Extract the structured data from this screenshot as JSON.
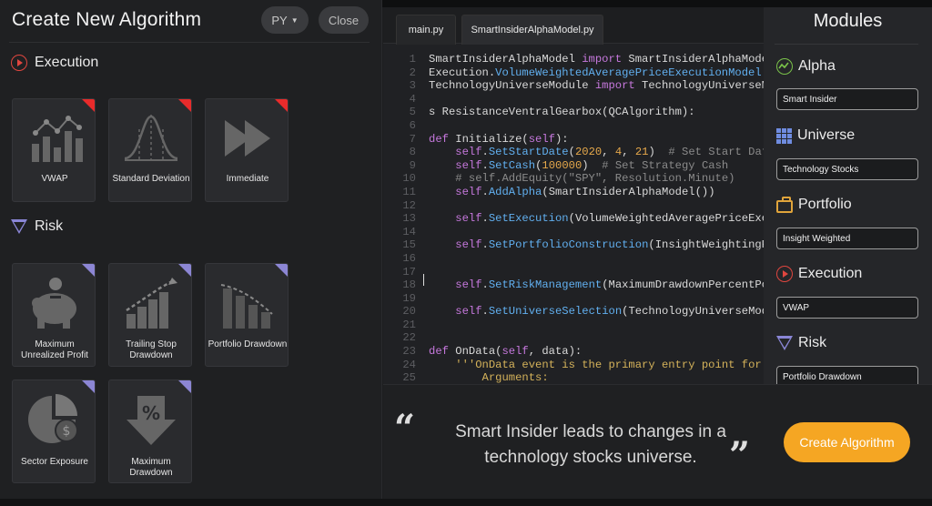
{
  "header": {
    "title": "Create New Algorithm",
    "language_label": "PY",
    "close_label": "Close"
  },
  "sections": {
    "execution_label": "Execution",
    "risk_label": "Risk"
  },
  "execution_cards": [
    {
      "label": "VWAP",
      "icon": "vwap-chart-icon",
      "selected": true
    },
    {
      "label": "Standard Deviation",
      "icon": "bell-curve-icon",
      "selected": true
    },
    {
      "label": "Immediate",
      "icon": "fast-forward-icon",
      "selected": true
    }
  ],
  "risk_cards": [
    {
      "label": "Maximum Unrealized Profit",
      "icon": "piggy-bank-icon"
    },
    {
      "label": "Trailing Stop Drawdown",
      "icon": "stairs-arrow-icon"
    },
    {
      "label": "Portfolio Drawdown",
      "icon": "declining-bars-icon"
    },
    {
      "label": "Sector Exposure",
      "icon": "pie-dollar-icon"
    },
    {
      "label": "Maximum Drawdown",
      "icon": "percent-arrow-down-icon"
    }
  ],
  "editor": {
    "tabs": [
      {
        "label": "main.py",
        "active": false
      },
      {
        "label": "SmartInsiderAlphaModel.py",
        "active": true
      }
    ],
    "lines": [
      {
        "n": "1",
        "html": "SmartInsiderAlphaModel <span class=\"kw\">import</span> SmartInsiderAlphaModel"
      },
      {
        "n": "2",
        "html": "Execution.<span class=\"fn\">VolumeWeightedAveragePriceExecutionModel</span> i"
      },
      {
        "n": "3",
        "html": "TechnologyUniverseModule <span class=\"kw\">import</span> TechnologyUniverseMo"
      },
      {
        "n": "4",
        "html": ""
      },
      {
        "n": "5",
        "html": "s ResistanceVentralGearbox(QCAlgorithm):"
      },
      {
        "n": "6",
        "html": ""
      },
      {
        "n": "7",
        "html": "<span class=\"kw\">def</span> Initialize(<span class=\"kw\">self</span>):"
      },
      {
        "n": "8",
        "html": "    <span class=\"kw\">self</span>.<span class=\"fn\">SetStartDate</span>(<span class=\"num\">2020</span>, <span class=\"num\">4</span>, <span class=\"num\">21</span>)  <span class=\"com\"># Set Start Date</span>"
      },
      {
        "n": "9",
        "html": "    <span class=\"kw\">self</span>.<span class=\"fn\">SetCash</span>(<span class=\"num\">100000</span>)  <span class=\"com\"># Set Strategy Cash</span>"
      },
      {
        "n": "10",
        "html": "    <span class=\"com\"># self.AddEquity(\"SPY\", Resolution.Minute)</span>"
      },
      {
        "n": "11",
        "html": "    <span class=\"kw\">self</span>.<span class=\"fn\">AddAlpha</span>(SmartInsiderAlphaModel())"
      },
      {
        "n": "12",
        "html": ""
      },
      {
        "n": "13",
        "html": "    <span class=\"kw\">self</span>.<span class=\"fn\">SetExecution</span>(VolumeWeightedAveragePriceExecu"
      },
      {
        "n": "14",
        "html": ""
      },
      {
        "n": "15",
        "html": "    <span class=\"kw\">self</span>.<span class=\"fn\">SetPortfolioConstruction</span>(InsightWeightingPor"
      },
      {
        "n": "16",
        "html": ""
      },
      {
        "n": "17",
        "html": ""
      },
      {
        "n": "18",
        "html": "    <span class=\"kw\">self</span>.<span class=\"fn\">SetRiskManagement</span>(MaximumDrawdownPercentPort"
      },
      {
        "n": "19",
        "html": ""
      },
      {
        "n": "20",
        "html": "    <span class=\"kw\">self</span>.<span class=\"fn\">SetUniverseSelection</span>(TechnologyUniverseModul"
      },
      {
        "n": "21",
        "html": ""
      },
      {
        "n": "22",
        "html": ""
      },
      {
        "n": "23",
        "html": "<span class=\"kw\">def</span> OnData(<span class=\"kw\">self</span>, data):"
      },
      {
        "n": "24",
        "html": "    <span class=\"str\">'''OnData event is the primary entry point for yo</span>"
      },
      {
        "n": "25",
        "html": "        <span class=\"str\">Arguments:</span>"
      }
    ]
  },
  "quote": {
    "text": "Smart Insider leads to changes in a technology stocks universe."
  },
  "create_button_label": "Create Algorithm",
  "modules": {
    "title": "Modules",
    "items": [
      {
        "label": "Alpha",
        "icon": "alpha-chart-icon",
        "value": "Smart Insider"
      },
      {
        "label": "Universe",
        "icon": "universe-grid-icon",
        "value": "Technology Stocks"
      },
      {
        "label": "Portfolio",
        "icon": "briefcase-icon",
        "value": "Insight Weighted"
      },
      {
        "label": "Execution",
        "icon": "execution-play-icon",
        "value": "VWAP"
      },
      {
        "label": "Risk",
        "icon": "risk-triangle-icon",
        "value": "Portfolio Drawdown"
      }
    ]
  },
  "colors": {
    "accent": "#f5a623",
    "execution": "#e0463f",
    "risk": "#8a86d6",
    "alpha": "#7ac24a",
    "universe": "#6f8ce0",
    "portfolio": "#e0a43b"
  }
}
